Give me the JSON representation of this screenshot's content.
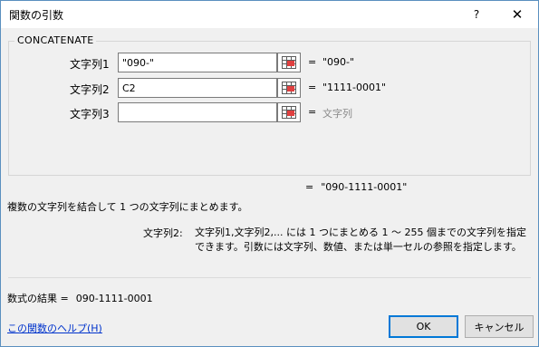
{
  "window": {
    "title": "関数の引数",
    "help_label": "?",
    "close_label": "✕"
  },
  "function": {
    "name": "CONCATENATE",
    "description": "複数の文字列を結合して 1 つの文字列にまとめます。",
    "formula_result_eq": "=",
    "formula_result": "\"090-1111-0001\""
  },
  "arguments": [
    {
      "label": "文字列1",
      "value": "\"090-\"",
      "placeholder": "",
      "eq": "=",
      "result": "\"090-\"",
      "result_is_placeholder": false
    },
    {
      "label": "文字列2",
      "value": "C2",
      "placeholder": "",
      "eq": "=",
      "result": "\"1111-0001\"",
      "result_is_placeholder": false
    },
    {
      "label": "文字列3",
      "value": "",
      "placeholder": "",
      "eq": "=",
      "result": "文字列",
      "result_is_placeholder": true
    }
  ],
  "argument_help": {
    "label": "文字列2:",
    "text": "文字列1,文字列2,... には 1 つにまとめる 1 ～ 255 個までの文字列を指定できます。引数には文字列、数値、または単一セルの参照を指定します。"
  },
  "result": {
    "label": "数式の結果 =",
    "value": "090-1111-0001"
  },
  "footer": {
    "help_link": "この関数のヘルプ(H)",
    "ok_label": "OK",
    "cancel_label": "キャンセル"
  },
  "colors": {
    "accent": "#0078d7",
    "link": "#0033cc",
    "background": "#f0f0f0"
  }
}
